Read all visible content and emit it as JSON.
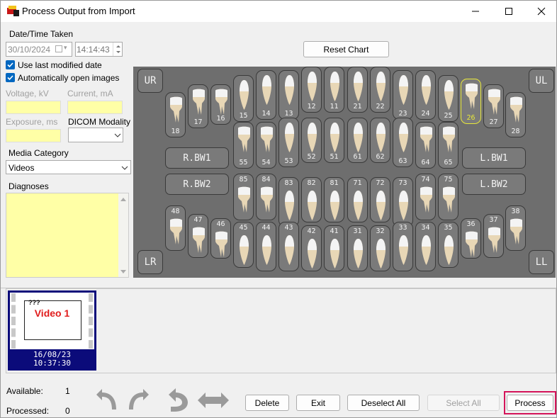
{
  "window": {
    "title": "Process Output from Import"
  },
  "left": {
    "datetime_label": "Date/Time Taken",
    "date_value": "30/10/2024",
    "time_value": "14:14:43",
    "use_last_modified": "Use last modified date",
    "auto_open": "Automatically open images",
    "voltage_label": "Voltage, kV",
    "current_label": "Current, mA",
    "exposure_label": "Exposure, ms",
    "dicom_label": "DICOM Modality",
    "dicom_value": "",
    "media_label": "Media Category",
    "media_value": "Videos",
    "diagnoses_label": "Diagnoses"
  },
  "chart": {
    "reset_label": "Reset Chart",
    "corners": {
      "ur": "UR",
      "ul": "UL",
      "lr": "LR",
      "ll": "LL"
    },
    "bw": {
      "rbw1": "R.BW1",
      "rbw2": "R.BW2",
      "lbw1": "L.BW1",
      "lbw2": "L.BW2"
    },
    "upper_teeth": [
      "18",
      "17",
      "16",
      "15",
      "14",
      "13",
      "12",
      "11",
      "21",
      "22",
      "23",
      "24",
      "25",
      "26",
      "27",
      "28"
    ],
    "upper_primary": [
      "55",
      "54",
      "53",
      "52",
      "51",
      "61",
      "62",
      "63",
      "64",
      "65"
    ],
    "lower_primary": [
      "85",
      "84",
      "83",
      "82",
      "81",
      "71",
      "72",
      "73",
      "74",
      "75"
    ],
    "lower_teeth": [
      "48",
      "47",
      "46",
      "45",
      "44",
      "43",
      "42",
      "41",
      "31",
      "32",
      "33",
      "34",
      "35",
      "36",
      "37",
      "38"
    ],
    "selected_tooth": "26"
  },
  "thumb": {
    "title": "Video 1",
    "badge": "???",
    "date": "16/08/23",
    "time": "10:37:30"
  },
  "status": {
    "available_label": "Available:",
    "available_value": "1",
    "processed_label": "Processed:",
    "processed_value": "0"
  },
  "buttons": {
    "delete": "Delete",
    "exit": "Exit",
    "deselect_all": "Deselect All",
    "select_all": "Select All",
    "process": "Process"
  },
  "colors": {
    "field_yellow": "#ffffa6",
    "chart_bg": "#6e6e6e",
    "accent": "#0067c0",
    "highlight": "#d4145a",
    "thumb_border": "#0b0b7a"
  }
}
